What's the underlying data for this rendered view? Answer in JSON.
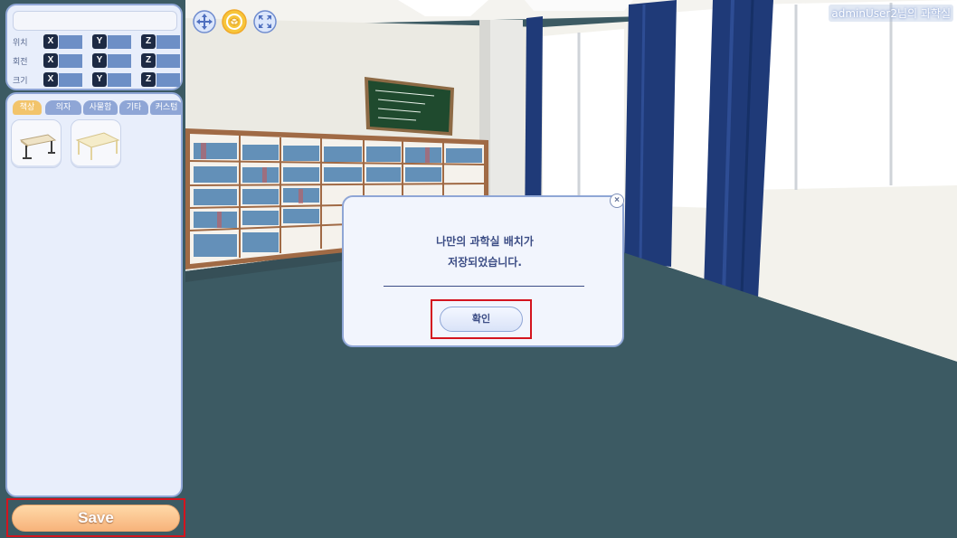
{
  "header": {
    "room_title": "adminUser2님의 과학실"
  },
  "transform_panel": {
    "rows": [
      {
        "label": "위치"
      },
      {
        "label": "회전"
      },
      {
        "label": "크기"
      }
    ],
    "axes": [
      "X",
      "Y",
      "Z"
    ]
  },
  "catalog": {
    "tabs": [
      "책상",
      "의자",
      "사물함",
      "기타",
      "커스텀"
    ],
    "active_tab": "책상"
  },
  "toolbar": {
    "icons": [
      "move-icon",
      "rotate-icon",
      "scale-icon"
    ]
  },
  "save_button": {
    "label": "Save"
  },
  "dialog": {
    "message_line1": "나만의 과학실 배치가",
    "message_line2": "저장되었습니다.",
    "confirm_label": "확인",
    "close_label": "×"
  },
  "colors": {
    "panel_border": "#8fa6d6",
    "highlight_red": "#d4141e",
    "save_orange": "#f7b37b",
    "floor": "#3c5a63",
    "curtain": "#1f3a78"
  }
}
